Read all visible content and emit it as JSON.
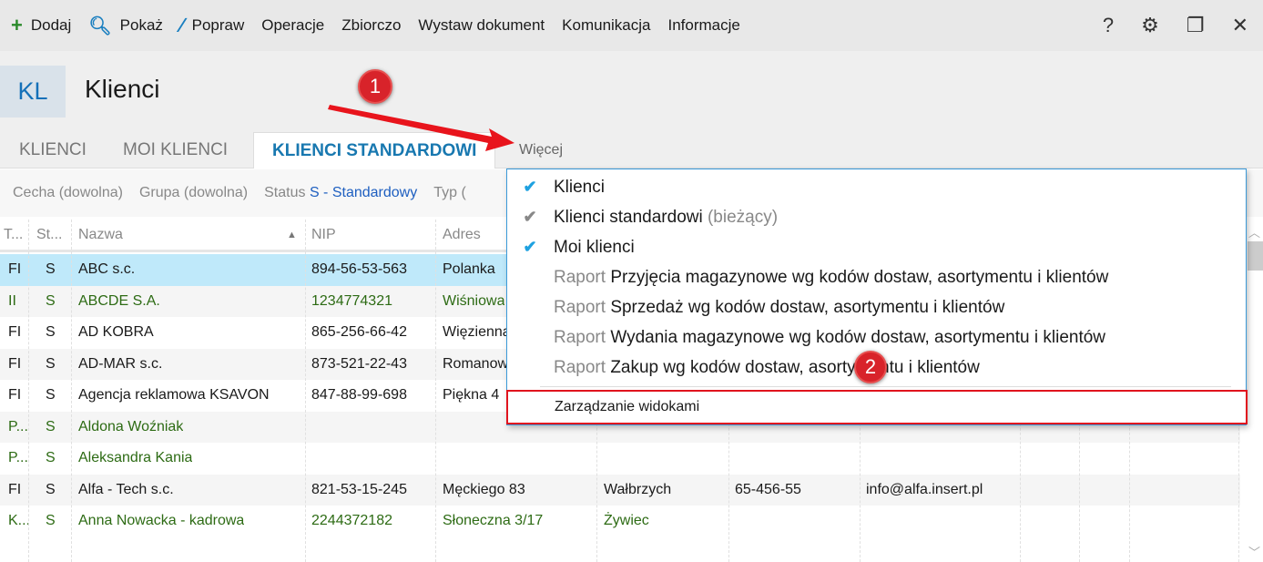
{
  "toolbar": {
    "items": [
      {
        "label": "Dodaj",
        "icon": "plus-icon"
      },
      {
        "label": "Pokaż",
        "icon": "search-icon"
      },
      {
        "label": "Popraw",
        "icon": "brush-icon"
      },
      {
        "label": "Operacje"
      },
      {
        "label": "Zbiorczo"
      },
      {
        "label": "Wystaw dokument"
      },
      {
        "label": "Komunikacja"
      },
      {
        "label": "Informacje"
      }
    ],
    "right": {
      "help": "?",
      "settings": "⚙",
      "restore": "❐",
      "close": "✕"
    }
  },
  "header": {
    "badge": "KL",
    "title": "Klienci"
  },
  "tabs": [
    "KLIENCI",
    "MOI KLIENCI",
    "KLIENCI STANDARDOWI"
  ],
  "more": "Więcej",
  "filters": {
    "cecha": "Cecha (dowolna)",
    "grupa": "Grupa (dowolna)",
    "status_label": "Status",
    "status_value": "S - Standardowy",
    "typ": "Typ ("
  },
  "table": {
    "columns": [
      "T...",
      "St...",
      "Nazwa",
      "NIP",
      "Adres"
    ],
    "rows": [
      {
        "t": "FI",
        "st": "S",
        "nazwa": "ABC s.c.",
        "nip": "894-56-53-563",
        "adres": "Polanka",
        "miasto": "",
        "kod": "",
        "email": ""
      },
      {
        "t": "II",
        "st": "S",
        "nazwa": "ABCDE S.A.",
        "nip": "1234774321",
        "adres": "Wiśniowa",
        "miasto": "",
        "kod": "",
        "email": ""
      },
      {
        "t": "FI",
        "st": "S",
        "nazwa": "AD KOBRA",
        "nip": "865-256-66-42",
        "adres": "Więzienna",
        "miasto": "",
        "kod": "",
        "email": ""
      },
      {
        "t": "FI",
        "st": "S",
        "nazwa": "AD-MAR s.c.",
        "nip": "873-521-22-43",
        "adres": "Romanowa",
        "miasto": "",
        "kod": "",
        "email": ""
      },
      {
        "t": "FI",
        "st": "S",
        "nazwa": "Agencja reklamowa KSAVON",
        "nip": "847-88-99-698",
        "adres": "Piękna 4",
        "miasto": "",
        "kod": "",
        "email": ""
      },
      {
        "t": "P...",
        "st": "S",
        "nazwa": "Aldona Woźniak",
        "nip": "",
        "adres": "",
        "miasto": "",
        "kod": "",
        "email": ""
      },
      {
        "t": "P...",
        "st": "S",
        "nazwa": "Aleksandra Kania",
        "nip": "",
        "adres": "",
        "miasto": "",
        "kod": "",
        "email": ""
      },
      {
        "t": "FI",
        "st": "S",
        "nazwa": "Alfa - Tech s.c.",
        "nip": "821-53-15-245",
        "adres": "Męckiego  83",
        "miasto": "Wałbrzych",
        "kod": "65-456-55",
        "email": "info@alfa.insert.pl"
      },
      {
        "t": "K...",
        "st": "S",
        "nazwa": "Anna Nowacka - kadrowa",
        "nip": "2244372182",
        "adres": "Słoneczna 3/17",
        "miasto": "Żywiec",
        "kod": "",
        "email": ""
      }
    ]
  },
  "menu": {
    "items": [
      {
        "prefix": "",
        "label": "Klienci",
        "suffix": "",
        "checked": true
      },
      {
        "prefix": "",
        "label": "Klienci standardowi",
        "suffix": " (bieżący)",
        "checked": true
      },
      {
        "prefix": "",
        "label": "Moi klienci",
        "suffix": "",
        "checked": true
      },
      {
        "prefix": "Raport ",
        "label": "Przyjęcia magazynowe wg kodów dostaw, asortymentu i klientów",
        "suffix": ""
      },
      {
        "prefix": "Raport ",
        "label": "Sprzedaż wg kodów dostaw, asortymentu i klientów",
        "suffix": ""
      },
      {
        "prefix": "Raport ",
        "label": "Wydania magazynowe wg kodów dostaw, asortymentu i klientów",
        "suffix": ""
      },
      {
        "prefix": "Raport ",
        "label": "Zakup wg kodów dostaw, asortymentu i klientów",
        "suffix": ""
      }
    ],
    "manage": "Zarządzanie widokami"
  },
  "annotations": [
    "1",
    "2"
  ],
  "colors": {
    "accent": "#1878b0",
    "selected_row": "#bfe9fa",
    "green_text": "#2d6b14",
    "highlight": "#e0141e"
  }
}
